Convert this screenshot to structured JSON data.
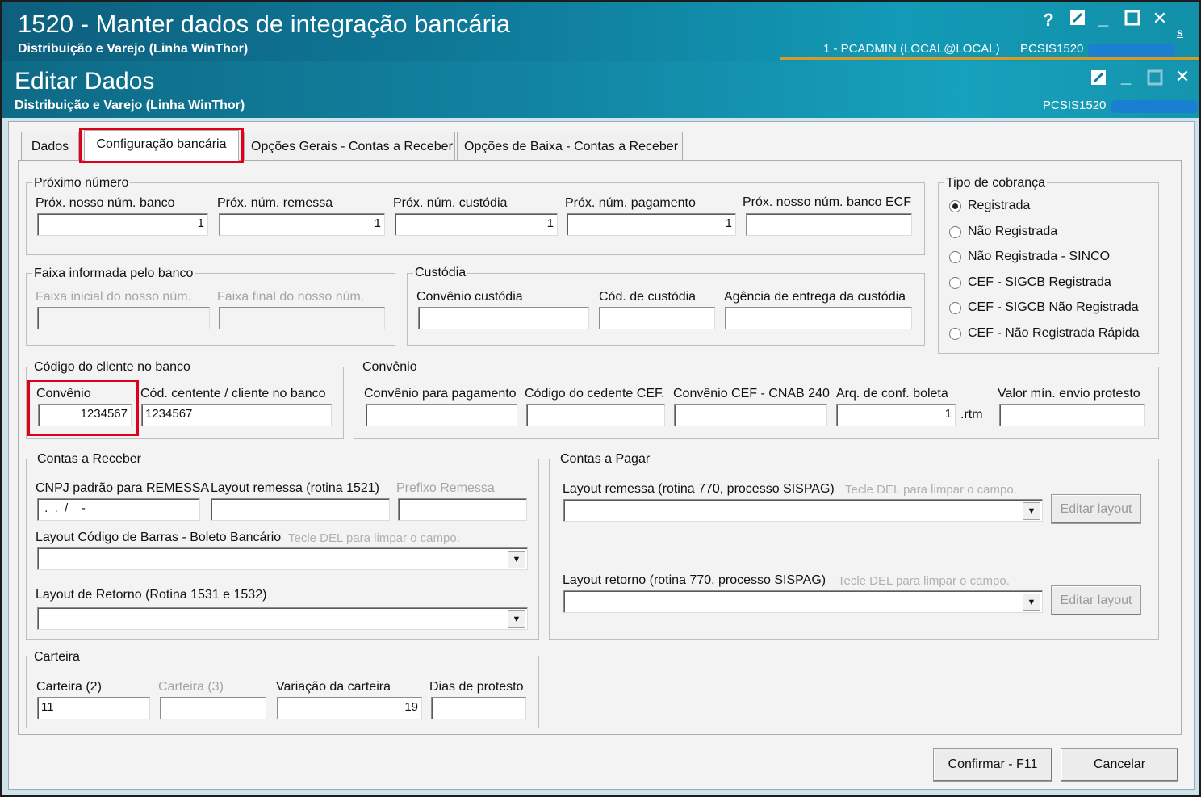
{
  "outer_window": {
    "title": "1520 - Manter dados de integração bancária",
    "subtitle": "Distribuição e Varejo (Linha WinThor)",
    "help": "?",
    "user": "1 - PCADMIN (LOCAL@LOCAL)",
    "routine": "PCSIS1520",
    "side_text": "s"
  },
  "inner_window": {
    "title": "Editar Dados",
    "subtitle": "Distribuição e Varejo (Linha WinThor)",
    "routine": "PCSIS1520"
  },
  "tabs": [
    {
      "label": "Dados"
    },
    {
      "label": "Configuração bancária"
    },
    {
      "label": "Opções Gerais - Contas a Receber"
    },
    {
      "label": "Opções de Baixa - Contas a Receber"
    }
  ],
  "proximo_numero": {
    "title": "Próximo número",
    "fields": [
      {
        "label": "Próx. nosso núm. banco",
        "value": "1"
      },
      {
        "label": "Próx. núm. remessa",
        "value": "1"
      },
      {
        "label": "Próx. núm. custódia",
        "value": "1"
      },
      {
        "label": "Próx. núm. pagamento",
        "value": "1"
      },
      {
        "label": "Próx. nosso núm. banco ECF",
        "value": ""
      }
    ]
  },
  "tipo_cobranca": {
    "title": "Tipo de cobrança",
    "options": [
      "Registrada",
      "Não Registrada",
      "Não Registrada - SINCO",
      "CEF - SIGCB Registrada",
      "CEF - SIGCB Não Registrada",
      "CEF - Não Registrada Rápida"
    ],
    "selected": "Registrada"
  },
  "faixa": {
    "title": "Faixa informada pelo banco",
    "inicial_label": "Faixa inicial do nosso núm.",
    "final_label": "Faixa final do nosso núm."
  },
  "custodia": {
    "title": "Custódia",
    "convenio_label": "Convênio custódia",
    "codigo_label": "Cód. de custódia",
    "agencia_label": "Agência de entrega da custódia"
  },
  "codigo_cliente": {
    "title": "Código do cliente no banco",
    "convenio_label": "Convênio",
    "convenio_value": "1234567",
    "cedente_label": "Cód. centente / cliente no banco",
    "cedente_value": "1234567"
  },
  "convenio": {
    "title": "Convênio",
    "pagamento_label": "Convênio para pagamento",
    "cedente_cef_label": "Código do cedente CEF.",
    "cnab_label": "Convênio CEF - CNAB 240",
    "arq_label": "Arq. de conf. boleta",
    "arq_value": "1",
    "arq_ext": ".rtm",
    "valor_min_label": "Valor mín. envio protesto"
  },
  "contas_receber": {
    "title": "Contas a Receber",
    "cnpj_label": "CNPJ padrão para REMESSA",
    "cnpj_value": " .  .  /    -",
    "layout_remessa_label": "Layout remessa (rotina 1521)",
    "prefixo_label": "Prefixo Remessa",
    "barras_label": "Layout Código de Barras - Boleto Bancário",
    "barras_hint": "Tecle DEL para limpar o campo.",
    "retorno_label": "Layout  de Retorno (Rotina 1531 e 1532)"
  },
  "contas_pagar": {
    "title": "Contas a Pagar",
    "remessa_label": "Layout remessa (rotina 770, processo SISPAG)",
    "remessa_hint": "Tecle DEL para limpar o campo.",
    "retorno_label": "Layout retorno (rotina 770, processo SISPAG)",
    "retorno_hint": "Tecle DEL para limpar o campo.",
    "edit_button": "Editar layout"
  },
  "carteira": {
    "title": "Carteira",
    "carteira2_label": "Carteira (2)",
    "carteira2_value": "11",
    "carteira3_label": "Carteira (3)",
    "variacao_label": "Variação da carteira",
    "variacao_value": "19",
    "dias_label": "Dias de protesto"
  },
  "buttons": {
    "confirm": "Confirmar - F11",
    "cancel": "Cancelar"
  },
  "colors": {
    "title_bar": "#0f7a99",
    "highlight": "#e0001b",
    "accent_line": "#d69a28"
  }
}
